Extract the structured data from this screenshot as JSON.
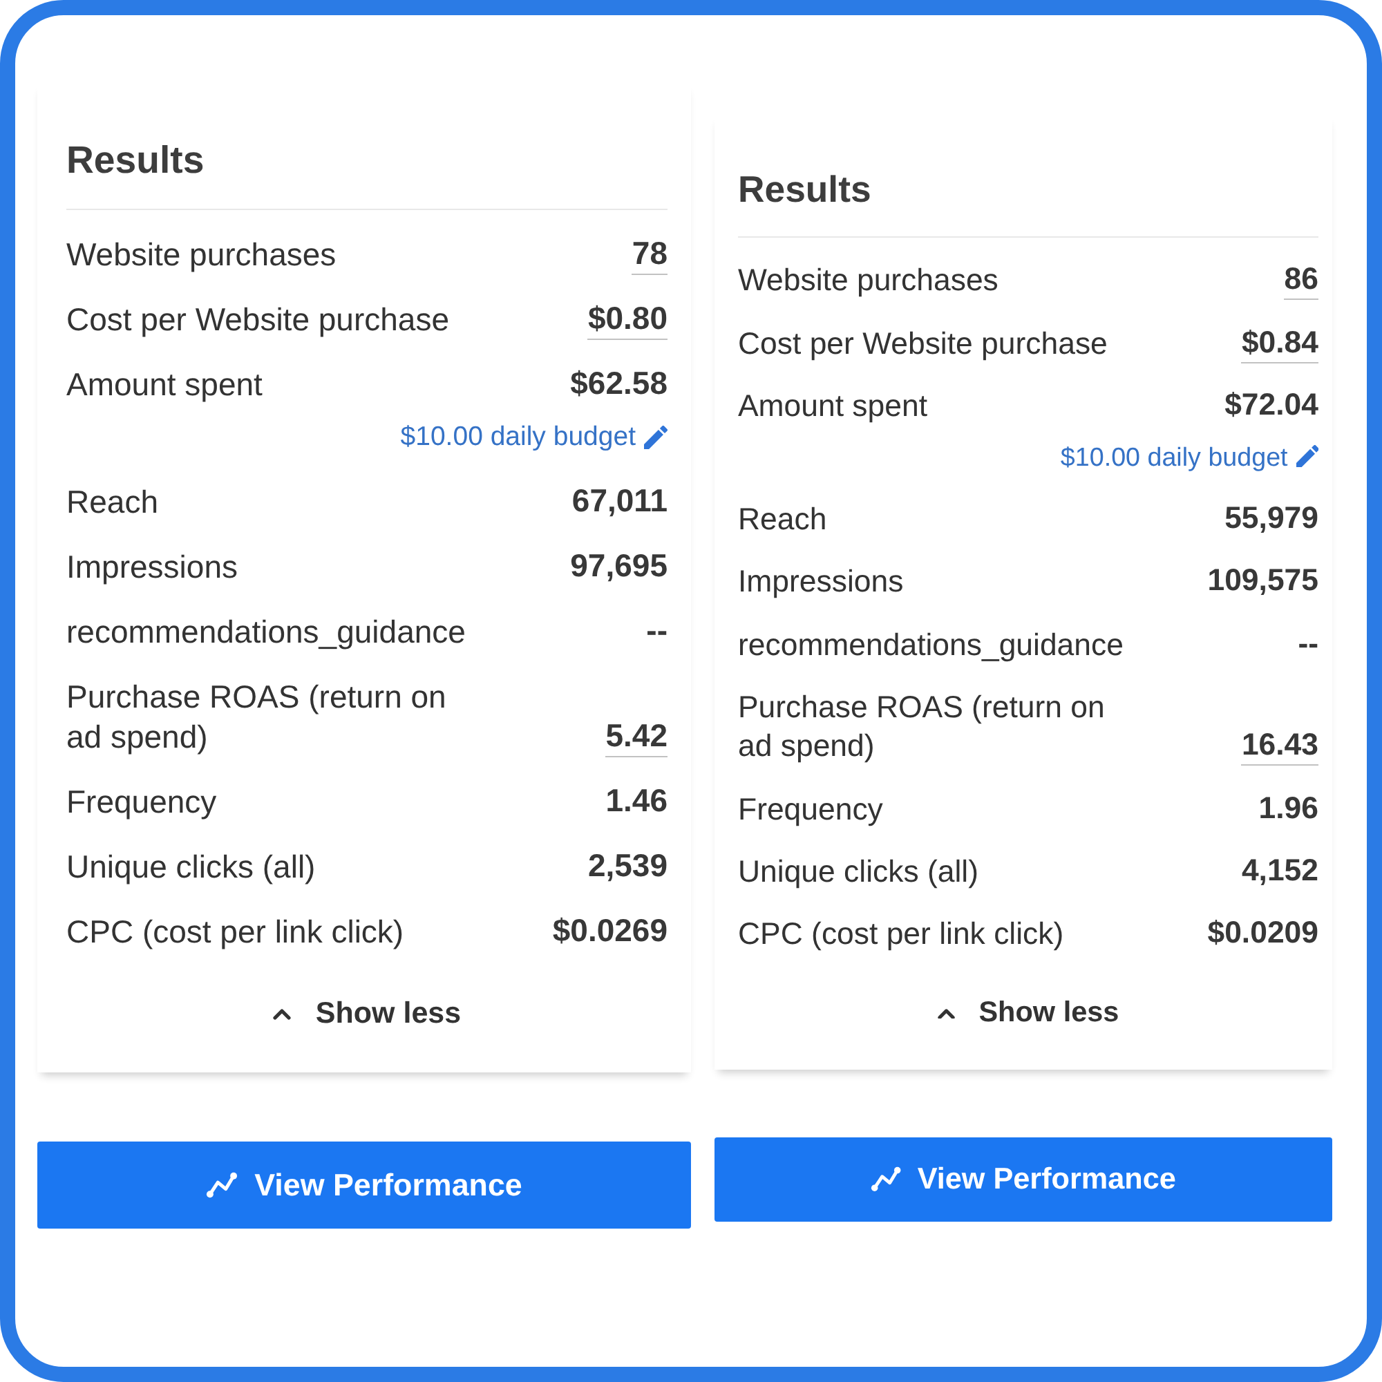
{
  "panels": [
    {
      "title": "Results",
      "rows": [
        {
          "label": "Website purchases",
          "value": "78",
          "underlined": true
        },
        {
          "label": "Cost per Website purchase",
          "value": "$0.80",
          "underlined": true
        },
        {
          "label": "Amount spent",
          "value": "$62.58",
          "underlined": false,
          "budget_link": "$10.00 daily budget"
        },
        {
          "label": "Reach",
          "value": "67,011",
          "underlined": false
        },
        {
          "label": "Impressions",
          "value": "97,695",
          "underlined": false
        },
        {
          "label": "recommendations_guidance",
          "value": "--",
          "underlined": false
        },
        {
          "label": "Purchase ROAS (return on ad spend)",
          "value": "5.42",
          "underlined": true
        },
        {
          "label": "Frequency",
          "value": "1.46",
          "underlined": false
        },
        {
          "label": "Unique clicks (all)",
          "value": "2,539",
          "underlined": false
        },
        {
          "label": "CPC (cost per link click)",
          "value": "$0.0269",
          "underlined": false
        }
      ],
      "toggle": {
        "label": "Show less",
        "expanded": true
      },
      "action_button": "View Performance"
    },
    {
      "title": "Results",
      "rows": [
        {
          "label": "Website purchases",
          "value": "86",
          "underlined": true
        },
        {
          "label": "Cost per Website purchase",
          "value": "$0.84",
          "underlined": true
        },
        {
          "label": "Amount spent",
          "value": "$72.04",
          "underlined": false,
          "budget_link": "$10.00 daily budget"
        },
        {
          "label": "Reach",
          "value": "55,979",
          "underlined": false
        },
        {
          "label": "Impressions",
          "value": "109,575",
          "underlined": false
        },
        {
          "label": "recommendations_guidance",
          "value": "--",
          "underlined": false
        },
        {
          "label": "Purchase ROAS (return on ad spend)",
          "value": "16.43",
          "underlined": true
        },
        {
          "label": "Frequency",
          "value": "1.96",
          "underlined": false
        },
        {
          "label": "Unique clicks (all)",
          "value": "4,152",
          "underlined": false
        },
        {
          "label": "CPC (cost per link click)",
          "value": "$0.0209",
          "underlined": false
        }
      ],
      "toggle": {
        "label": "Show less",
        "expanded": true
      },
      "action_button": "View Performance"
    }
  ]
}
